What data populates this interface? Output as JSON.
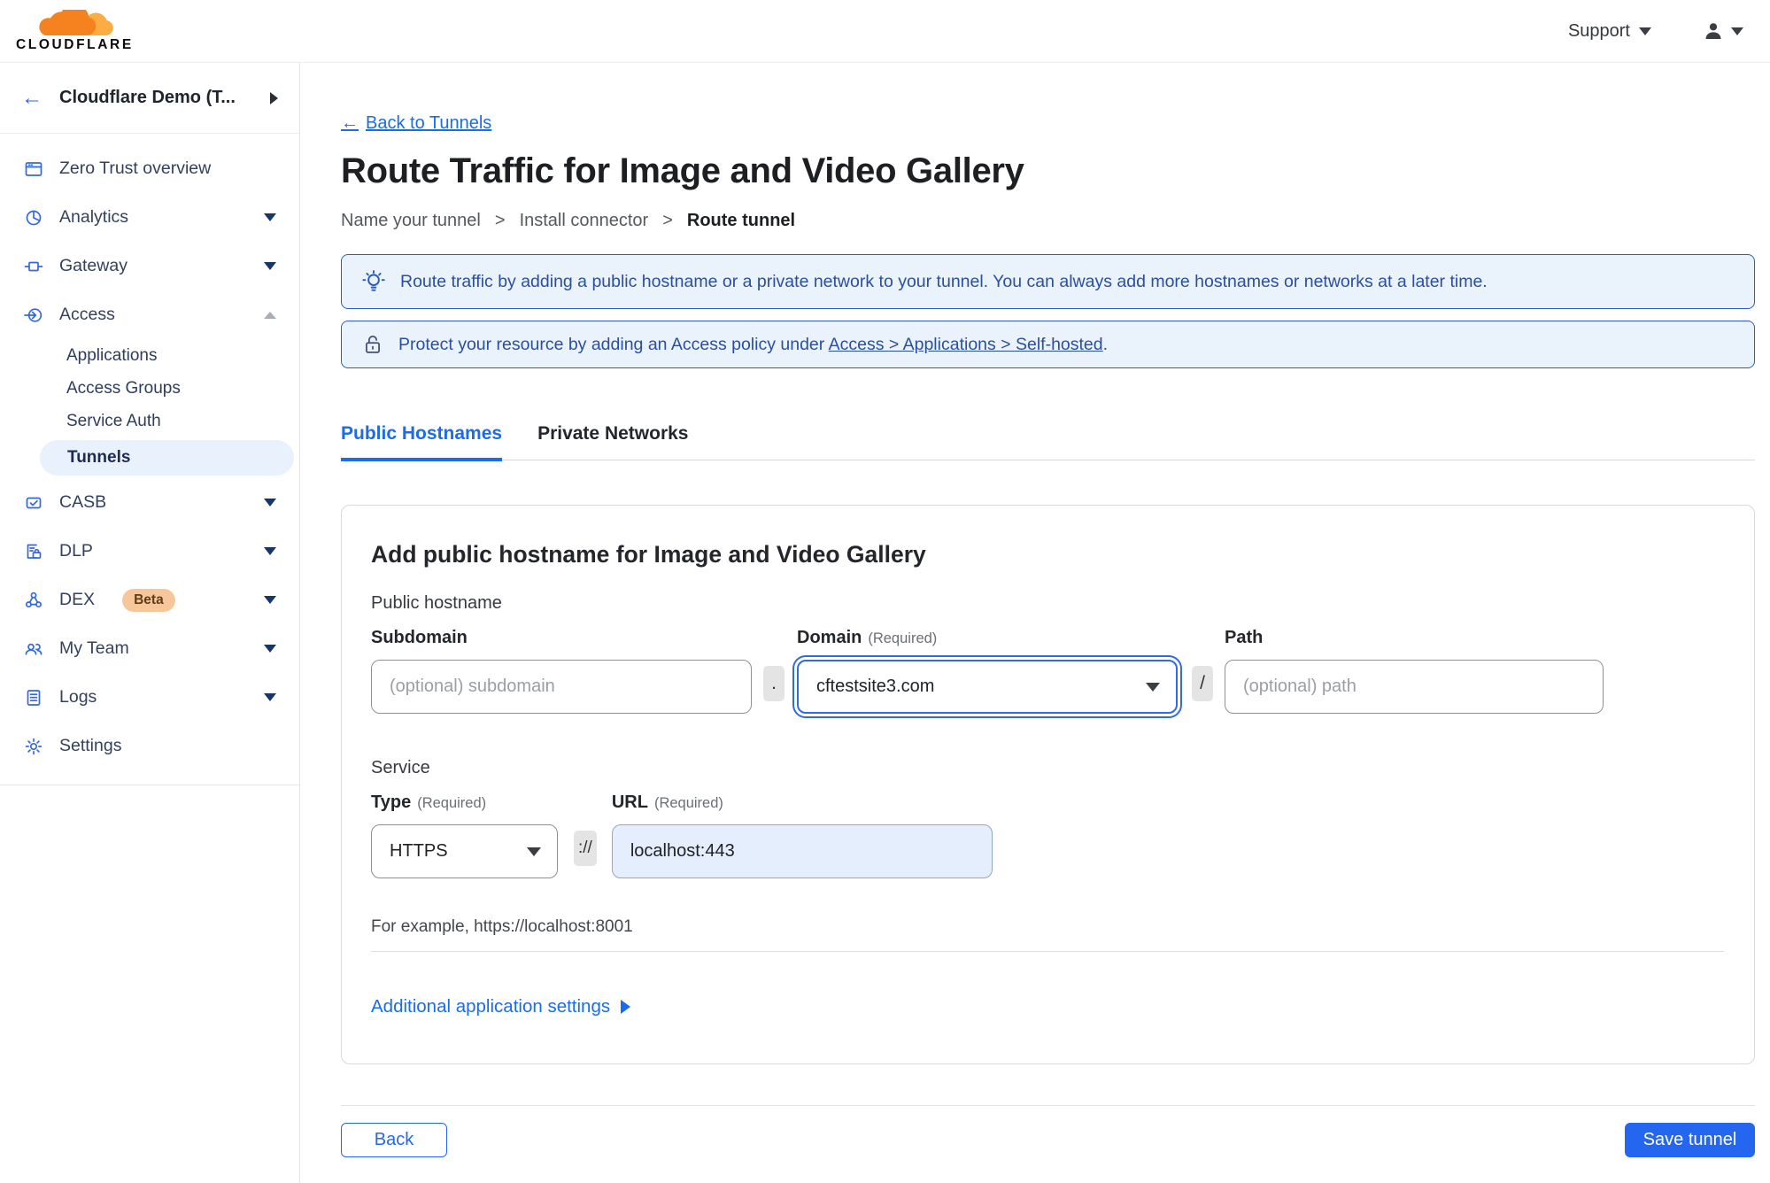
{
  "header": {
    "brand": "CLOUDFLARE",
    "support_label": "Support"
  },
  "sidebar": {
    "back_arrow": "←",
    "account_label": "Cloudflare Demo (T...",
    "items": [
      {
        "label": "Zero Trust overview"
      },
      {
        "label": "Analytics"
      },
      {
        "label": "Gateway"
      },
      {
        "label": "Access"
      },
      {
        "label": "CASB"
      },
      {
        "label": "DLP"
      },
      {
        "label": "DEX",
        "badge": "Beta"
      },
      {
        "label": "My Team"
      },
      {
        "label": "Logs"
      },
      {
        "label": "Settings"
      }
    ],
    "access_children": [
      {
        "label": "Applications"
      },
      {
        "label": "Access Groups"
      },
      {
        "label": "Service Auth"
      },
      {
        "label": "Tunnels",
        "active": true
      }
    ]
  },
  "main": {
    "back_arrow": "←",
    "back_link": "Back to Tunnels",
    "title": "Route Traffic for Image and Video Gallery",
    "step_separator": ">",
    "steps": [
      {
        "label": "Name your tunnel"
      },
      {
        "label": "Install connector"
      },
      {
        "label": "Route tunnel"
      }
    ],
    "banners": [
      {
        "text": "Route traffic by adding a public hostname or a private network to your tunnel. You can always add more hostnames or networks at a later time."
      },
      {
        "text_prefix": "Protect your resource by adding an Access policy under ",
        "link_text": "Access > Applications > Self-hosted",
        "text_suffix": "."
      }
    ],
    "tabs": [
      {
        "label": "Public Hostnames"
      },
      {
        "label": "Private Networks"
      }
    ],
    "form": {
      "heading": "Add public hostname for Image and Video Gallery",
      "public_hostname_label": "Public hostname",
      "subdomain_label": "Subdomain",
      "subdomain_placeholder": "(optional) subdomain",
      "dot_separator": ".",
      "domain_label": "Domain",
      "required_note": "(Required)",
      "domain_value": "cftestsite3.com",
      "slash_separator": "/",
      "path_label": "Path",
      "path_placeholder": "(optional) path",
      "service_label": "Service",
      "type_label": "Type",
      "type_value": "HTTPS",
      "scheme_separator": "://",
      "url_label": "URL",
      "url_value": "localhost:443",
      "example_hint": "For example, https://localhost:8001",
      "additional_settings_label": "Additional application settings"
    },
    "footer": {
      "back_label": "Back",
      "save_label": "Save tunnel"
    }
  },
  "colors": {
    "brand_orange": "#F6821F",
    "brand_orange_light": "#FBAD41",
    "primary_blue": "#2566F1",
    "link_blue": "#1A6CEB",
    "banner_bg": "#EAF2FC",
    "banner_border": "#2D5CBE",
    "banner_text": "#2A4FA2",
    "sidebar_icon_blue": "#3468E0",
    "active_pill_bg": "#E8F1FC",
    "beta_badge_bg": "#F7C79B",
    "beta_badge_text": "#5F3C1A",
    "url_field_bg": "#E4EEFC"
  }
}
